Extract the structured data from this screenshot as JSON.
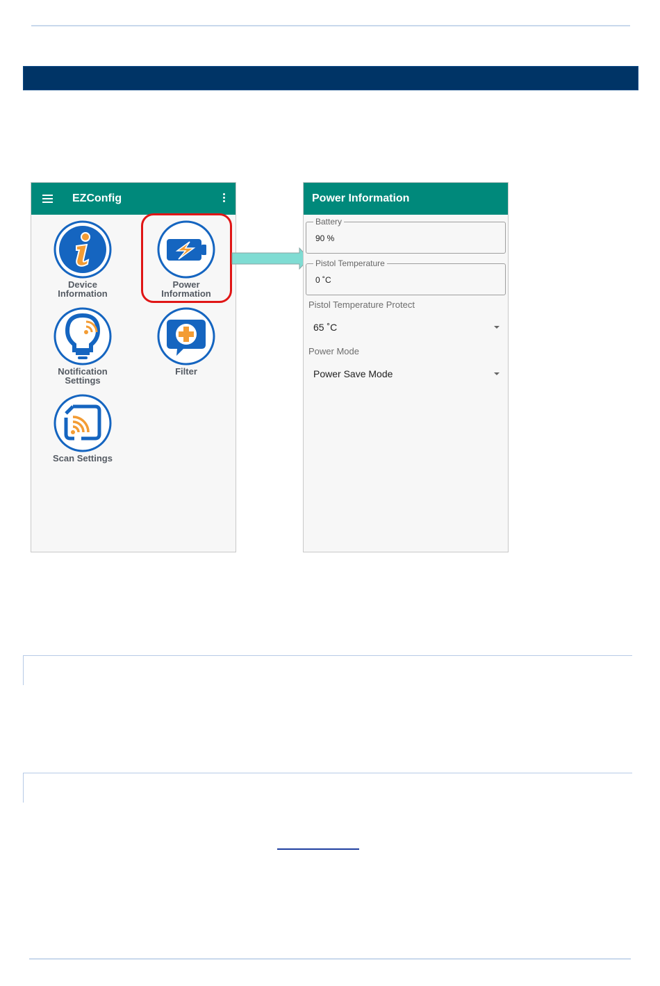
{
  "left_screen": {
    "title": "EZConfig",
    "tiles": [
      {
        "line1": "Device",
        "line2": "Information"
      },
      {
        "line1": "Power",
        "line2": "Information"
      },
      {
        "line1": "Notification",
        "line2": "Settings"
      },
      {
        "line1": "Filter",
        "line2": ""
      },
      {
        "line1": "Scan Settings",
        "line2": ""
      }
    ]
  },
  "right_screen": {
    "title": "Power Information",
    "battery": {
      "label": "Battery",
      "value": "90 %"
    },
    "pistol_temperature": {
      "label": "Pistol Temperature",
      "value": "0 ˚C"
    },
    "temperature_protect": {
      "label": "Pistol Temperature Protect",
      "value": "65 ˚C"
    },
    "power_mode": {
      "label": "Power Mode",
      "value": "Power Save Mode"
    }
  },
  "colors": {
    "appbar": "#00897b",
    "banner": "#003466",
    "highlight": "#e01616",
    "icon_blue": "#1565c0",
    "icon_orange": "#f39c34"
  }
}
